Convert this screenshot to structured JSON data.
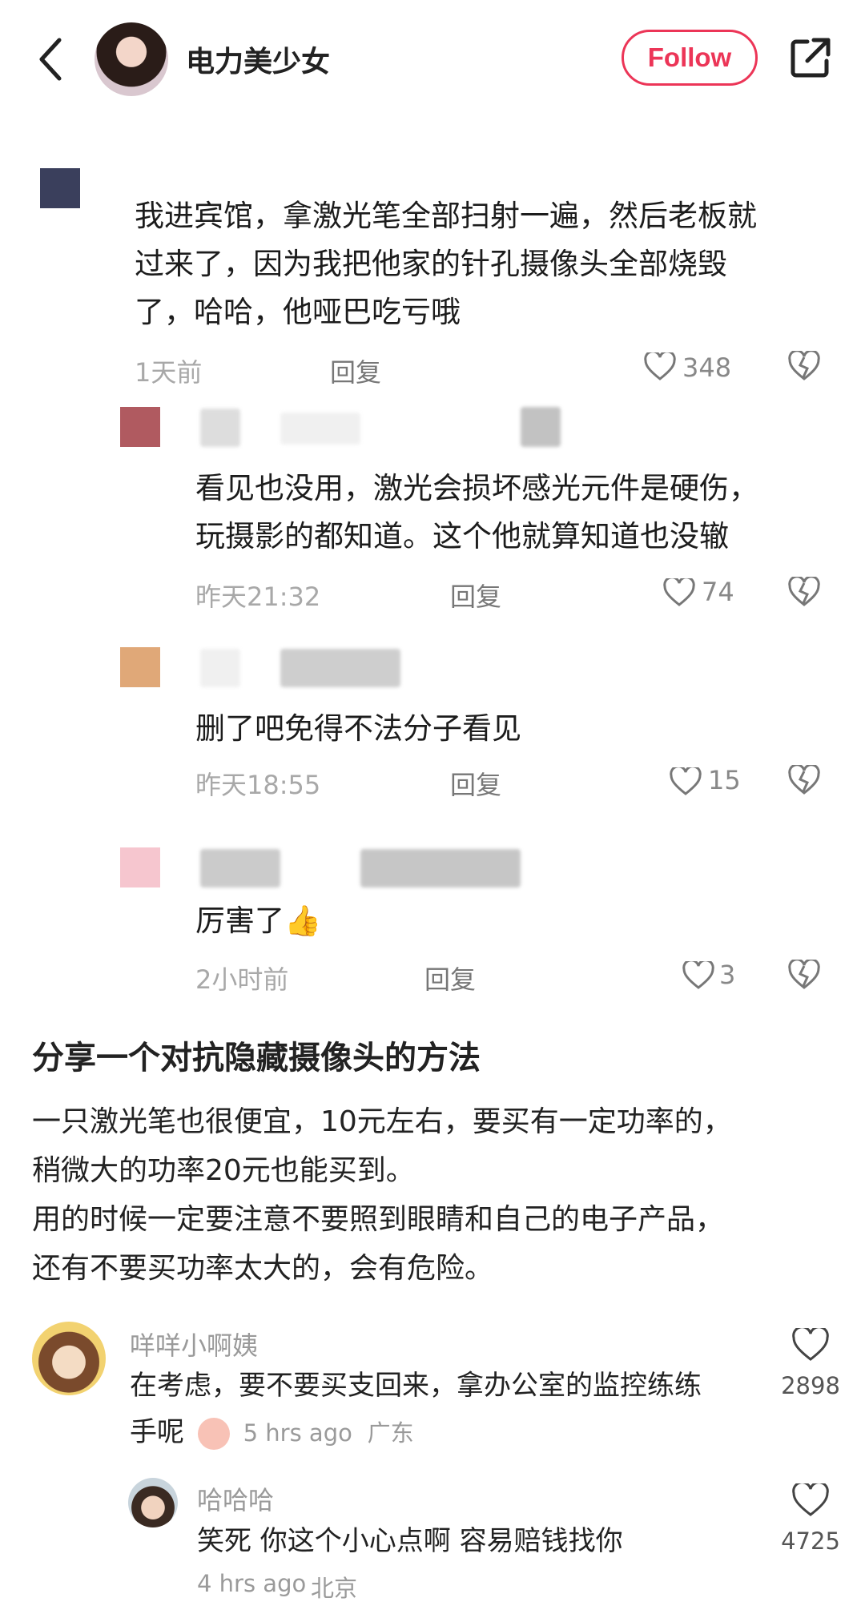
{
  "header": {
    "author": "电力美少女",
    "follow_label": "Follow"
  },
  "screenshot_comments": [
    {
      "text_lines": [
        "我进宾馆，拿激光笔全部扫射一遍，然后老板就",
        "过来了，因为我把他家的针孔摄像头全部烧毁",
        "了，哈哈，他哑巴吃亏哦"
      ],
      "time": "1天前",
      "reply": "回复",
      "likes": "348",
      "avatar_color": "#3a3f5c"
    },
    {
      "text_lines": [
        "看见也没用，激光会损坏感光元件是硬伤，",
        "玩摄影的都知道。这个他就算知道也没辙"
      ],
      "time": "昨天21:32",
      "reply": "回复",
      "likes": "74",
      "avatar_color": "#b05a60"
    },
    {
      "text_lines": [
        "删了吧免得不法分子看见"
      ],
      "time": "昨天18:55",
      "reply": "回复",
      "likes": "15",
      "avatar_color": "#e0a878"
    },
    {
      "text_lines": [
        "厉害了"
      ],
      "emoji": "👍",
      "time": "2小时前",
      "reply": "回复",
      "likes": "3",
      "avatar_color": "#f6c6cf"
    }
  ],
  "article": {
    "title": "分享一个对抗隐藏摄像头的方法",
    "lines": [
      "一只激光笔也很便宜，10元左右，要买有一定功率的，",
      "稍微大的功率20元也能买到。",
      "用的时候一定要注意不要照到眼睛和自己的电子产品，",
      "还有不要买功率太大的，会有危险。"
    ]
  },
  "comments": [
    {
      "user": "咩咩小啊姨",
      "text": "在考虑，要不要买支回来，拿办公室的监控练练",
      "text2": "手呢",
      "time": "5 hrs ago",
      "location": "广东",
      "likes": "2898"
    },
    {
      "user": "哈哈哈",
      "text": "笑死 你这个小心点啊 容易赔钱找你",
      "time": "4 hrs ago",
      "location": "北京",
      "likes": "4725"
    }
  ]
}
